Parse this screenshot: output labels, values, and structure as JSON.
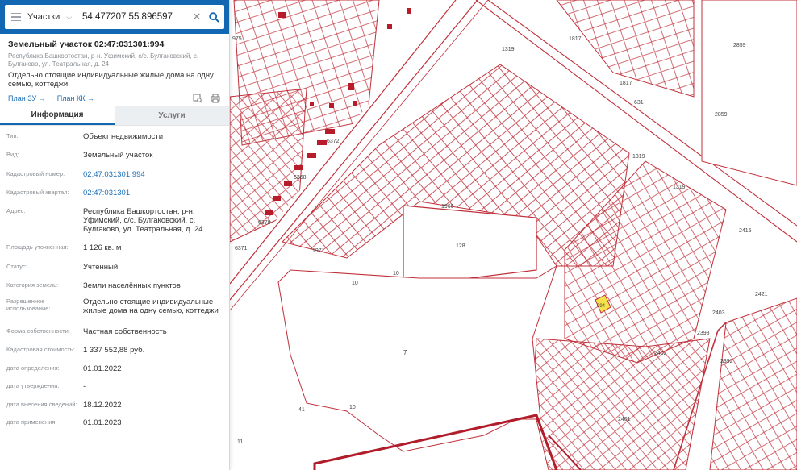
{
  "search": {
    "type_label": "Участки",
    "coords_value": "54.477207 55.896597"
  },
  "object": {
    "title": "Земельный участок 02:47:031301:994",
    "address_small": "Республика Башкортостан, р-н. Уфимский, с/с. Булгаковский, с. Булгаково, ул. Театральная, д. 24",
    "purpose": "Отдельно стоящие индивидуальные жилые дома на одну семью, коттеджи",
    "link_plan_zu": "План ЗУ →",
    "link_plan_kk": "План КК →"
  },
  "tabs": {
    "info": "Информация",
    "services": "Услуги"
  },
  "rows": [
    {
      "label": "Тип:",
      "value": "Объект недвижимости"
    },
    {
      "label": "Вид:",
      "value": "Земельный участок"
    },
    {
      "label": "Кадастровый номер:",
      "value": "02:47:031301:994"
    },
    {
      "label": "Кадастровый квартал:",
      "value": "02:47:031301"
    },
    {
      "label": "Адрес:",
      "value": "Республика Башкортостан, р-н. Уфимский, с/с. Булгаковский, с. Булгаково, ул. Театральная, д. 24"
    },
    {
      "label": "Площадь уточненная:",
      "value": "1 126 кв. м"
    },
    {
      "label": "Статус:",
      "value": "Учтенный"
    },
    {
      "label": "Категория земель:",
      "value": "Земли населённых пунктов"
    },
    {
      "label": "Разрешенное использование:",
      "value": "Отдельно стоящие индивидуальные жилые дома на одну семью, коттеджи"
    },
    {
      "label": "Форма собственности:",
      "value": "Частная собственность"
    },
    {
      "label": "Кадастровая стоимость:",
      "value": "1 337 552,88 руб."
    },
    {
      "label": "дата определения:",
      "value": "01.01.2022"
    },
    {
      "label": "дата утверждения:",
      "value": "-"
    },
    {
      "label": "дата внесения сведений:",
      "value": "18.12.2022"
    },
    {
      "label": "дата применения:",
      "value": "01.01.2023"
    }
  ],
  "map_labels": {
    "parcel_7": "7",
    "parcel_128": "128",
    "parcel_1319a": "1319",
    "parcel_1319b": "1319",
    "parcel_1319c": "1319",
    "parcel_1817a": "1817",
    "parcel_1817b": "1817",
    "parcel_2859a": "2859",
    "parcel_2859b": "2859",
    "parcel_6372": "6372",
    "parcel_6368": "6368",
    "parcel_6378": "6378",
    "parcel_6371": "6371",
    "parcel_2415": "2415",
    "parcel_2421": "2421",
    "parcel_2403": "2403",
    "parcel_2398": "2398",
    "parcel_2392": "2392",
    "parcel_2401": "2401",
    "parcel_2402": "2402",
    "parcel_10a": "10",
    "parcel_10b": "10",
    "parcel_10c": "10",
    "parcel_11": "11",
    "parcel_41": "41",
    "parcel_631": "631",
    "parcel_975": "975",
    "parcel_1971": "1971",
    "parcel_1966": "1966",
    "parcel_994": "994"
  },
  "colors": {
    "header_blue": "#1267b3",
    "parcel_red": "#c0303a",
    "selected_yellow": "#f5e24a",
    "link_blue": "#1c6fb8"
  }
}
